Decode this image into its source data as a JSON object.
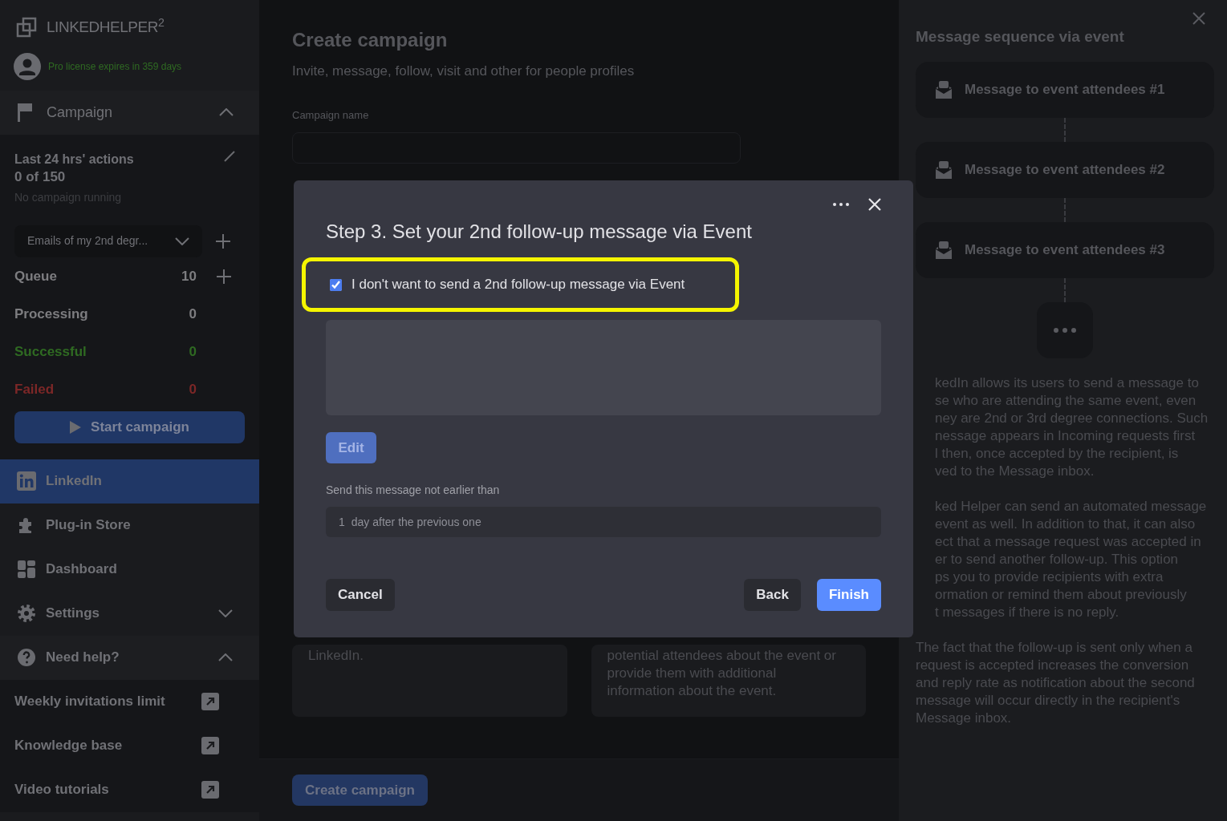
{
  "sidebar": {
    "logo": "LINKEDHELPER$^{2}$",
    "license": "Pro license expires in 359 days",
    "campaign_section": {
      "label": "Campaign",
      "expanded": true
    },
    "actions": {
      "title": "Last 24 hrs' actions",
      "count": "0 of 150",
      "status": "No campaign running"
    },
    "campaign_select": {
      "value": "Emails of my 2nd degr..."
    },
    "stats": [
      {
        "label": "Queue",
        "value": "10",
        "color": "#7d7d80",
        "addable": true
      },
      {
        "label": "Processing",
        "value": "0",
        "color": "#7d7d80",
        "addable": false
      },
      {
        "label": "Successful",
        "value": "0",
        "color": "#2f6a22",
        "addable": false
      },
      {
        "label": "Failed",
        "value": "0",
        "color": "#7c2727",
        "addable": false
      }
    ],
    "start_button": "Start campaign",
    "nav": [
      {
        "label": "LinkedIn",
        "selected": true,
        "kind": "link"
      },
      {
        "label": "Plug-in Store",
        "selected": false,
        "kind": "link"
      },
      {
        "label": "Dashboard",
        "selected": false,
        "kind": "link"
      },
      {
        "label": "Settings",
        "selected": false,
        "kind": "group",
        "expanded": false
      },
      {
        "label": "Need help?",
        "selected": false,
        "kind": "group",
        "expanded": true
      }
    ],
    "help_links": [
      "Weekly invitations limit",
      "Knowledge base",
      "Video tutorials"
    ]
  },
  "main": {
    "title": "Create campaign",
    "subtitle": "Invite, message, follow, visit and other for people profiles",
    "name_label": "Campaign name",
    "cards": [
      {
        "lines": [
          "LinkedIn."
        ]
      },
      {
        "lines": [
          "potential attendees about the event or",
          "provide them with additional",
          "information about the event."
        ]
      }
    ],
    "create_button": "Create campaign"
  },
  "modal": {
    "title": "Step 3. Set your 2nd follow-up message via Event",
    "skip": {
      "label": "I don't want to send a 2nd follow-up message via Event",
      "checked": true,
      "highlighted": true
    },
    "edit_button": "Edit",
    "delay_label": "Send this message not earlier than",
    "delay_value": "1",
    "delay_unit": "day after the previous one",
    "buttons": [
      {
        "label": "Cancel",
        "kind": "secondary"
      },
      {
        "label": "Back",
        "kind": "secondary"
      },
      {
        "label": "Finish",
        "kind": "primary"
      }
    ]
  },
  "panel": {
    "title": "Message sequence via event",
    "steps": [
      "Message to event attendees #1",
      "Message to event attendees #2",
      "Message to event attendees #3"
    ],
    "paragraphs": [
      {
        "lines": [
          "kedIn allows its users to send a message to",
          "se who are attending the same event, even",
          "ney are 2nd or 3rd degree connections. Such",
          "nessage appears in Incoming requests first",
          "l then, once accepted by the recipient, is",
          "ved to the Message inbox."
        ]
      },
      {
        "lines": [
          "ked Helper can send an automated message",
          "event as well. In addition to that, it can also",
          "ect that a message request was accepted in",
          "er to send another follow-up. This option",
          "ps you to provide recipients with extra",
          "ormation or remind them about previously",
          "t messages if there is no reply."
        ]
      },
      {
        "lines": [
          "The fact that the follow-up is sent only when a",
          "request is accepted increases the conversion",
          "and reply rate as notification about the second",
          "message will occur directly in the recipient's",
          "Message inbox."
        ]
      }
    ]
  }
}
